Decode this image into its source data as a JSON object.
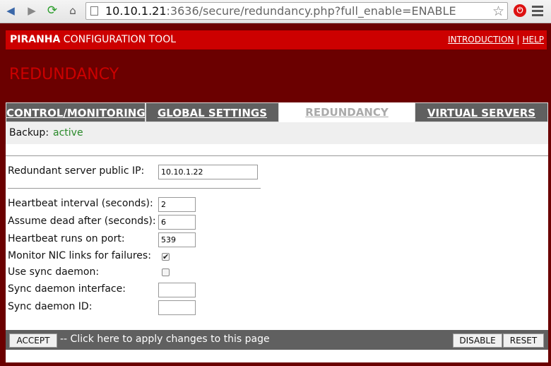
{
  "browser": {
    "url_host": "10.10.1.21",
    "url_rest": ":3636/secure/redundancy.php?full_enable=ENABLE"
  },
  "header": {
    "brand_bold": "PIRANHA",
    "brand_rest": " CONFIGURATION TOOL",
    "links": [
      "INTRODUCTION",
      "HELP"
    ],
    "link_sep": "|"
  },
  "page_title": "REDUNDANCY",
  "tabs": [
    "CONTROL/MONITORING",
    "GLOBAL SETTINGS",
    "REDUNDANCY",
    "VIRTUAL SERVERS"
  ],
  "backup": {
    "label": "Backup:",
    "value": "active",
    "value_color": "#2a8a2a"
  },
  "form": {
    "public_ip_label": "Redundant server public IP:",
    "public_ip_value": "10.10.1.22",
    "heartbeat_interval_label": "Heartbeat interval (seconds):",
    "heartbeat_interval_value": "2",
    "dead_after_label": "Assume dead after (seconds):",
    "dead_after_value": "6",
    "heartbeat_port_label": "Heartbeat runs on port:",
    "heartbeat_port_value": "539",
    "monitor_nic_label": "Monitor NIC links for failures:",
    "monitor_nic_checked": "✔",
    "sync_daemon_label": "Use sync daemon:",
    "sync_interface_label": "Sync daemon interface:",
    "sync_interface_value": "",
    "sync_id_label": "Sync daemon ID:",
    "sync_id_value": ""
  },
  "footer": {
    "accept_label": "ACCEPT",
    "accept_hint": "-- Click here to apply changes to this page",
    "disable_label": "DISABLE",
    "reset_label": "RESET"
  }
}
